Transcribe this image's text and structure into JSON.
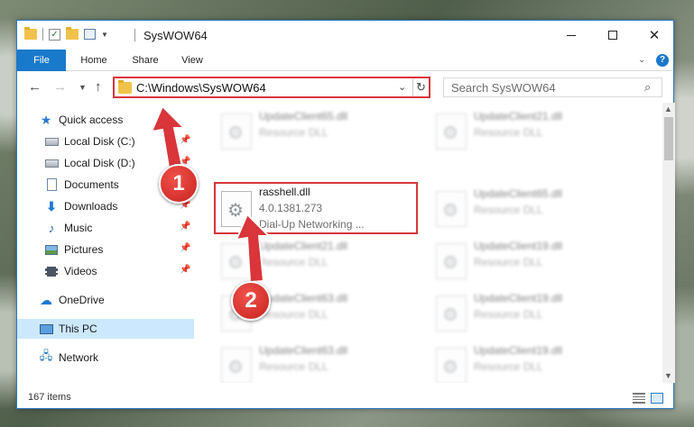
{
  "window": {
    "title": "SysWOW64",
    "controls": {
      "minimize": "min",
      "maximize": "max",
      "close": "✕"
    }
  },
  "ribbon": {
    "tabs": [
      {
        "label": "File"
      },
      {
        "label": "Home"
      },
      {
        "label": "Share"
      },
      {
        "label": "View"
      }
    ],
    "help": "?"
  },
  "navigation": {
    "address_path": "C:\\Windows\\SysWOW64",
    "search_placeholder": "Search SysWOW64"
  },
  "sidebar": {
    "items": [
      {
        "label": "Quick access",
        "icon": "star-icon"
      },
      {
        "label": "Local Disk (C:)",
        "icon": "drive-icon",
        "pinned": true
      },
      {
        "label": "Local Disk (D:)",
        "icon": "drive-icon",
        "pinned": true
      },
      {
        "label": "Documents",
        "icon": "documents-icon",
        "pinned": true
      },
      {
        "label": "Downloads",
        "icon": "downloads-icon",
        "pinned": true
      },
      {
        "label": "Music",
        "icon": "music-icon",
        "pinned": true
      },
      {
        "label": "Pictures",
        "icon": "pictures-icon",
        "pinned": true
      },
      {
        "label": "Videos",
        "icon": "videos-icon",
        "pinned": true
      },
      {
        "label": "OneDrive",
        "icon": "onedrive-icon"
      },
      {
        "label": "This PC",
        "icon": "pc-icon",
        "selected": true
      },
      {
        "label": "Network",
        "icon": "network-icon"
      }
    ]
  },
  "files": {
    "highlighted": {
      "name": "rasshell.dll",
      "version": "4.0.1381.273",
      "description": "Dial-Up Networking ..."
    },
    "blurred": [
      {
        "name": "UpdateClient65.dll",
        "type": "Resource DLL"
      },
      {
        "name": "UpdateClient21.dll",
        "type": "Resource DLL"
      },
      {
        "name": "UpdateClient65.dll",
        "type": "Resource DLL"
      },
      {
        "name": "UpdateClient21.dll",
        "type": "Resource DLL"
      },
      {
        "name": "UpdateClient19.dll",
        "type": "Resource DLL"
      },
      {
        "name": "UpdateClient63.dll",
        "type": "Resource DLL"
      },
      {
        "name": "UpdateClient19.dll",
        "type": "Resource DLL"
      },
      {
        "name": "UpdateClient63.dll",
        "type": "Resource DLL"
      },
      {
        "name": "UpdateClient19.dll",
        "type": "Resource DLL"
      }
    ]
  },
  "status": {
    "item_count": "167 items"
  },
  "annotations": {
    "callout1": "1",
    "callout2": "2",
    "accent_color": "#d9353a"
  }
}
